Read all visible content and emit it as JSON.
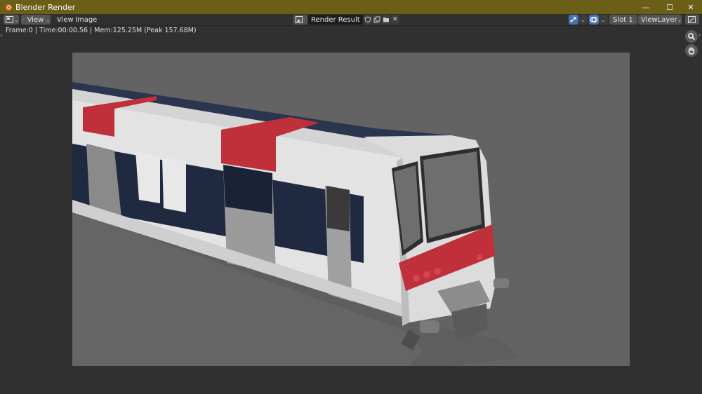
{
  "window": {
    "title": "Blender Render",
    "minimize": "—",
    "maximize": "☐",
    "close": "✕"
  },
  "header": {
    "view_dropdown": "View",
    "menus": [
      "View",
      "Image"
    ],
    "image_name": "Render Result",
    "slot": "Slot 1",
    "view_layer": "ViewLayer"
  },
  "status": {
    "text": "Frame:0 | Time:00:00.56 | Mem:125.25M (Peak 157.68M)"
  },
  "colors": {
    "titlebar": "#6b5e17",
    "accent": "#4772b3",
    "train_red": "#c0303a",
    "train_navy": "#1f2940",
    "train_white": "#e6e6e6"
  }
}
